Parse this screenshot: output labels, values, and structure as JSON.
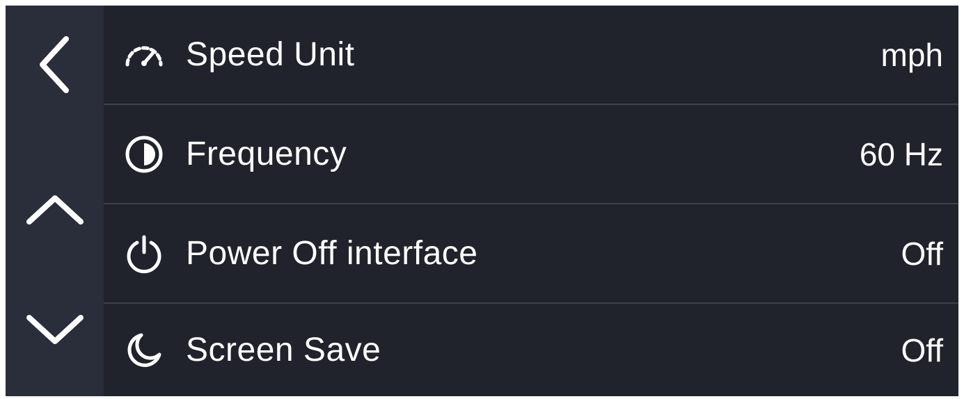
{
  "sidebar": {
    "back_icon": "chevron-left-icon",
    "up_icon": "chevron-up-icon",
    "down_icon": "chevron-down-icon"
  },
  "settings": [
    {
      "icon": "speedometer-icon",
      "label": "Speed Unit",
      "value": "mph"
    },
    {
      "icon": "contrast-icon",
      "label": "Frequency",
      "value": "60 Hz"
    },
    {
      "icon": "power-icon",
      "label": "Power Off interface",
      "value": "Off"
    },
    {
      "icon": "moon-icon",
      "label": "Screen Save",
      "value": "Off"
    }
  ],
  "colors": {
    "background": "#20232b",
    "sidebar": "#2a2e3a",
    "divider": "#3e424e",
    "text": "#ffffff"
  }
}
